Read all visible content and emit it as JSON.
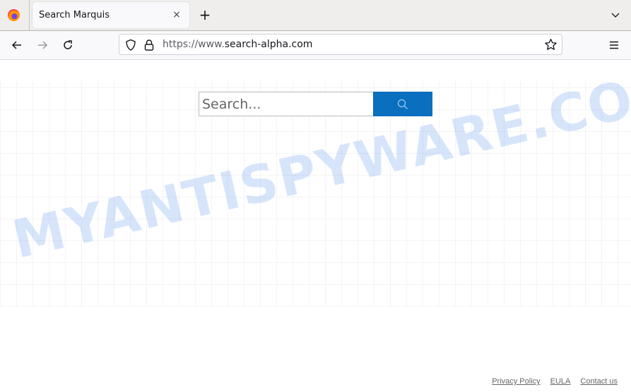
{
  "browser": {
    "tab": {
      "title": "Search Marquis",
      "close_label": "×"
    },
    "new_tab_label": "+",
    "url": {
      "prefix": "https://www.",
      "domain": "search-alpha.com"
    }
  },
  "page": {
    "search": {
      "placeholder": "Search..."
    },
    "watermark": "MYANTISPYWARE.COM",
    "footer": {
      "links": [
        {
          "label": "Privacy Policy"
        },
        {
          "label": "EULA"
        },
        {
          "label": "Contact us"
        }
      ]
    },
    "colors": {
      "search_button": "#0a6fbf"
    }
  }
}
